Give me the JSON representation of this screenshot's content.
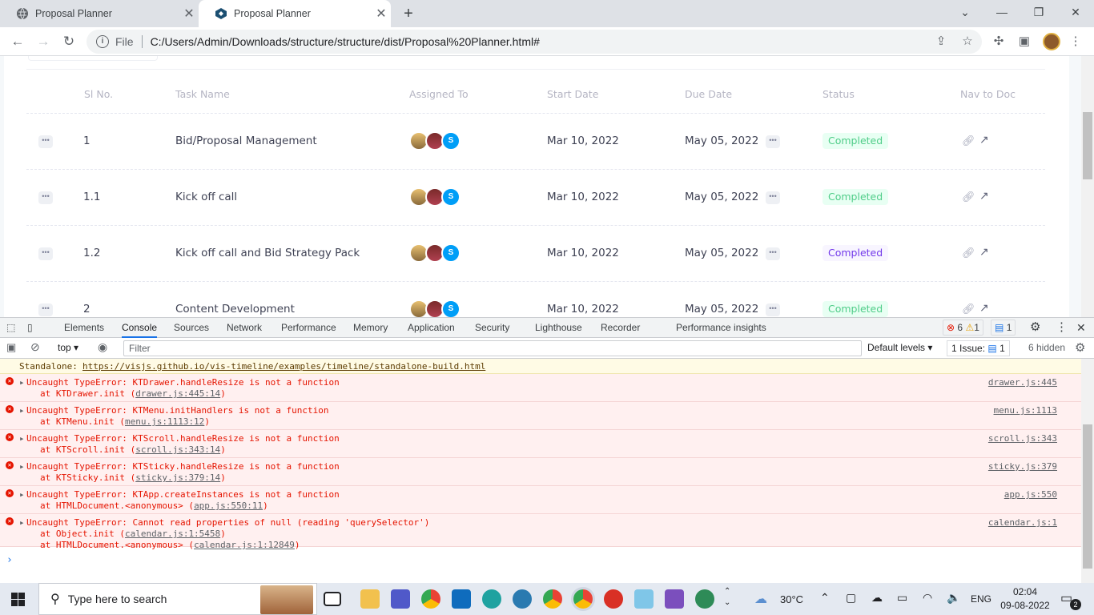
{
  "browser": {
    "tabs": [
      {
        "title": "Proposal Planner"
      },
      {
        "title": "Proposal Planner"
      }
    ],
    "address": {
      "scheme_label": "File",
      "url": "C:/Users/Admin/Downloads/structure/structure/dist/Proposal%20Planner.html#"
    }
  },
  "table": {
    "headers": {
      "sl": "Sl No.",
      "task": "Task Name",
      "assigned": "Assigned To",
      "start": "Start Date",
      "due": "Due Date",
      "status": "Status",
      "nav": "Nav to Doc"
    },
    "rows": [
      {
        "sl": "1",
        "task": "Bid/Proposal Management",
        "avatar_initial": "S",
        "start": "Mar 10, 2022",
        "due": "May 05, 2022",
        "status": "Completed",
        "status_color": "#50cd89"
      },
      {
        "sl": "1.1",
        "task": "Kick off call",
        "avatar_initial": "S",
        "start": "Mar 10, 2022",
        "due": "May 05, 2022",
        "status": "Completed",
        "status_color": "#50cd89"
      },
      {
        "sl": "1.2",
        "task": "Kick off call and Bid Strategy Pack",
        "avatar_initial": "S",
        "start": "Mar 10, 2022",
        "due": "May 05, 2022",
        "status": "Completed",
        "status_color": "#7239ea"
      },
      {
        "sl": "2",
        "task": "Content Development",
        "avatar_initial": "S",
        "start": "Mar 10, 2022",
        "due": "May 05, 2022",
        "status": "Completed",
        "status_color": "#50cd89"
      }
    ]
  },
  "devtools": {
    "tabs": [
      "Elements",
      "Console",
      "Sources",
      "Network",
      "Performance",
      "Memory",
      "Application",
      "Security",
      "Lighthouse",
      "Recorder",
      "Performance insights"
    ],
    "error_count": "6",
    "warning_count": "1",
    "info_count": "1",
    "context": "top",
    "filter_placeholder": "Filter",
    "levels": "Default levels",
    "issues": "1 Issue:",
    "issues_count": "1",
    "hidden": "6 hidden",
    "standalone_label": "Standalone:",
    "standalone_link": "https://visjs.github.io/vis-timeline/examples/timeline/standalone-build.html",
    "messages": [
      {
        "text": "Uncaught TypeError: KTDrawer.handleResize is not a function",
        "at1": "at KTDrawer.init (",
        "loc1": "drawer.js:445:14",
        "src": "drawer.js:445"
      },
      {
        "text": "Uncaught TypeError: KTMenu.initHandlers is not a function",
        "at1": "at KTMenu.init (",
        "loc1": "menu.js:1113:12",
        "src": "menu.js:1113"
      },
      {
        "text": "Uncaught TypeError: KTScroll.handleResize is not a function",
        "at1": "at KTScroll.init (",
        "loc1": "scroll.js:343:14",
        "src": "scroll.js:343"
      },
      {
        "text": "Uncaught TypeError: KTSticky.handleResize is not a function",
        "at1": "at KTSticky.init (",
        "loc1": "sticky.js:379:14",
        "src": "sticky.js:379"
      },
      {
        "text": "Uncaught TypeError: KTApp.createInstances is not a function",
        "at1": "at HTMLDocument.<anonymous> (",
        "loc1": "app.js:550:11",
        "src": "app.js:550"
      },
      {
        "text": "Uncaught TypeError: Cannot read properties of null (reading 'querySelector')",
        "at1": "at Object.init (",
        "loc1": "calendar.js:1:5458",
        "at2": "at HTMLDocument.<anonymous> (",
        "loc2": "calendar.js:1:12849",
        "src": "calendar.js:1"
      }
    ]
  },
  "taskbar": {
    "search_placeholder": "Type here to search",
    "weather": "30°C",
    "lang": "ENG",
    "time": "02:04",
    "date": "09-08-2022",
    "notifications": "2"
  }
}
